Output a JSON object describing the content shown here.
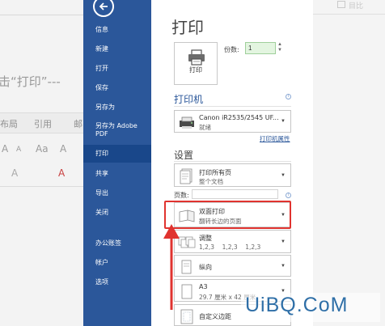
{
  "background_doc": {
    "big_text": "击“打印”---",
    "ribbon_tabs": [
      "布局",
      "引用",
      "邮"
    ],
    "font_row": [
      "A",
      "A",
      "Aa",
      "A"
    ],
    "font_row2": [
      "A",
      "A"
    ]
  },
  "right_fade": {
    "text": "目比"
  },
  "sidebar": {
    "items": [
      {
        "label": "信息"
      },
      {
        "label": "新建"
      },
      {
        "label": "打开"
      },
      {
        "label": "保存"
      },
      {
        "label": "另存为"
      },
      {
        "label": "另存为 Adobe\nPDF"
      },
      {
        "label": "打印"
      },
      {
        "label": "共享"
      },
      {
        "label": "导出"
      },
      {
        "label": "关闭"
      },
      {
        "label": "办公账签"
      },
      {
        "label": "帐户"
      },
      {
        "label": "选项"
      }
    ],
    "selected_index": 6
  },
  "print": {
    "title": "打印",
    "button_label": "打印",
    "copies_label": "份数:",
    "copies_value": "1"
  },
  "printer": {
    "heading": "打印机",
    "name": "Canon iR2535/2545 UF...",
    "status": "就绪",
    "properties_link": "打印机属性"
  },
  "settings": {
    "heading": "设置",
    "print_range": {
      "title": "打印所有页",
      "subtitle": "整个文档"
    },
    "pages_label": "页数:",
    "pages_value": "",
    "duplex": {
      "title": "双面打印",
      "subtitle": "翻转长边的页面"
    },
    "collate": {
      "title": "调整",
      "subtitle": "1,2,3    1,2,3    1,2,3"
    },
    "orientation": {
      "title": "纵向"
    },
    "paper": {
      "title": "A3",
      "subtitle": "29.7 厘米 x 42 厘米"
    },
    "margins": {
      "title": "自定义边距"
    }
  },
  "watermark": "UiBQ.CoM",
  "colors": {
    "sidebar": "#2b579a",
    "sidebar_selected": "#19478a",
    "highlight": "#e0332f",
    "copies_bg": "#e3f5e0"
  }
}
